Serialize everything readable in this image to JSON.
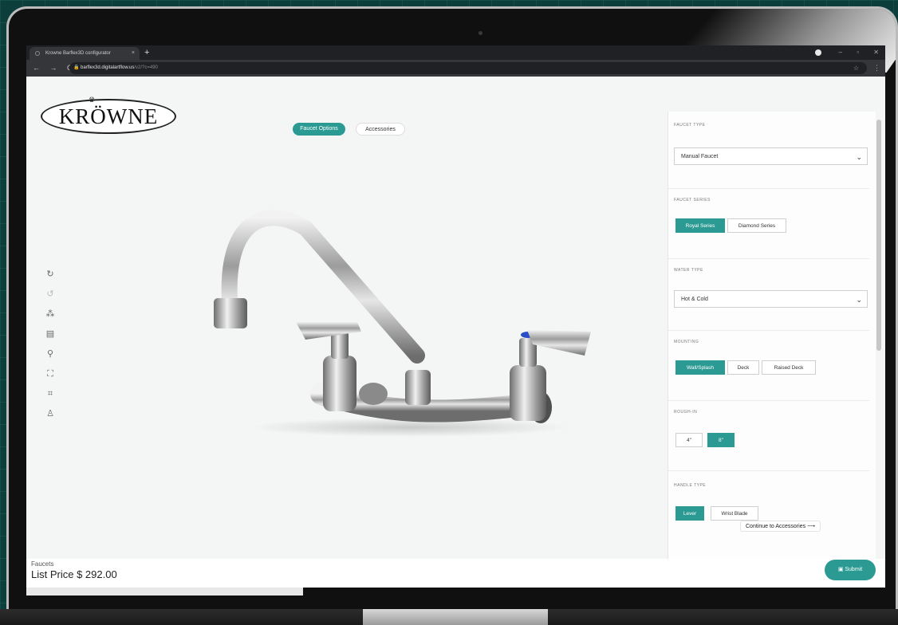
{
  "browser": {
    "tab_title": "Krowne Barflex3D configurator",
    "tab_close": "×",
    "new_tab": "+",
    "url_host": "barflex3d.digitalartflow.us",
    "url_path": "/v2/?c=490",
    "nav": {
      "back": "←",
      "forward": "→",
      "reload": "C"
    },
    "window_controls": {
      "minimize": "–",
      "restore": "▫",
      "close": "✕"
    }
  },
  "brand": {
    "logo_text": "KRÖWNE",
    "crown": "♛"
  },
  "top_tabs": {
    "faucet_options": "Faucet Options",
    "accessories": "Accessories"
  },
  "toolbar": {
    "icons": [
      "redo-icon",
      "undo-icon",
      "explode-icon",
      "clipboard-icon",
      "measure-icon",
      "fullscreen-icon",
      "fit-view-icon",
      "ar-view-icon"
    ]
  },
  "panel": {
    "faucet_type": {
      "label": "FAUCET TYPE",
      "value": "Manual Faucet"
    },
    "faucet_series": {
      "label": "FAUCET SERIES",
      "options": [
        "Royal Series",
        "Diamond Series"
      ],
      "selected": "Royal Series"
    },
    "water_type": {
      "label": "WATER TYPE",
      "value": "Hot & Cold"
    },
    "mounting": {
      "label": "MOUNTING",
      "options": [
        "Wall/Splash",
        "Deck",
        "Raised Deck"
      ],
      "selected": "Wall/Splash"
    },
    "rough_in": {
      "label": "ROUGH-IN",
      "options": [
        "4\"",
        "8\""
      ],
      "selected": "8\""
    },
    "handle_type": {
      "label": "HANDLE TYPE",
      "options": [
        "Lever",
        "Wrist Blade"
      ],
      "selected": "Lever"
    },
    "continue_label": "Continue to Accessories",
    "continue_arrow": "⟶"
  },
  "footer": {
    "category": "Faucets",
    "price": "List Price $ 292.00",
    "submit_label": "Submit"
  },
  "colors": {
    "accent": "#2b9a93",
    "background": "#0c3f3b"
  }
}
